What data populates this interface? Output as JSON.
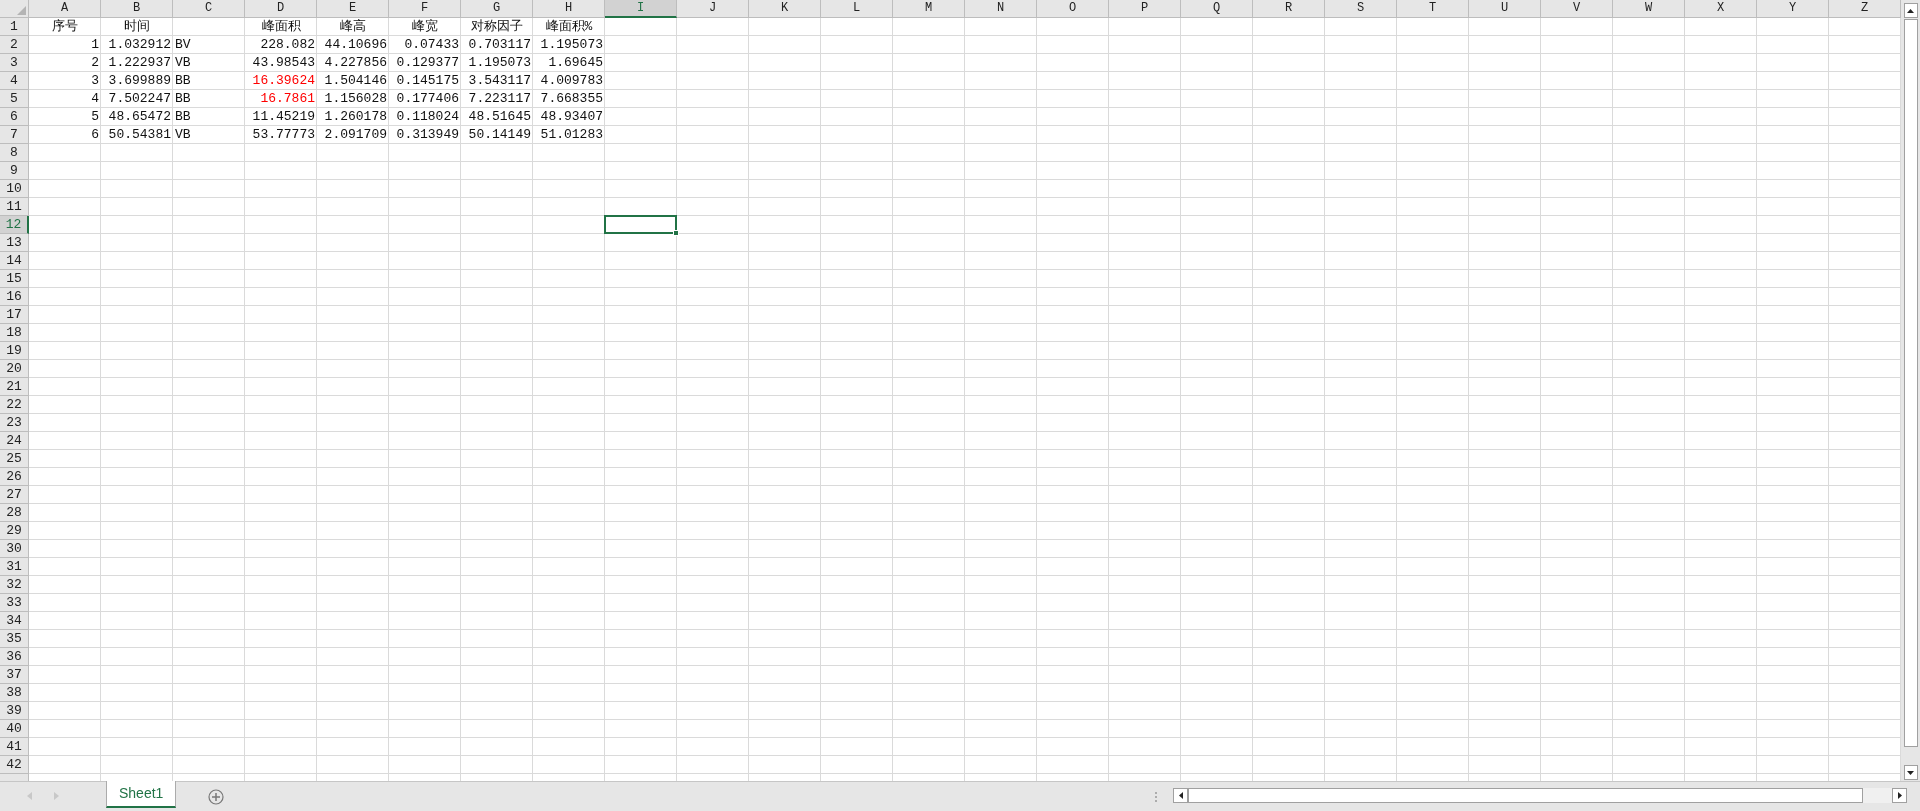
{
  "columns": [
    {
      "label": "A",
      "selected": false
    },
    {
      "label": "B",
      "selected": false
    },
    {
      "label": "C",
      "selected": false
    },
    {
      "label": "D",
      "selected": false
    },
    {
      "label": "E",
      "selected": false
    },
    {
      "label": "F",
      "selected": false
    },
    {
      "label": "G",
      "selected": false
    },
    {
      "label": "H",
      "selected": false
    },
    {
      "label": "I",
      "selected": true
    },
    {
      "label": "J",
      "selected": false
    },
    {
      "label": "K",
      "selected": false
    },
    {
      "label": "L",
      "selected": false
    },
    {
      "label": "M",
      "selected": false
    },
    {
      "label": "N",
      "selected": false
    },
    {
      "label": "O",
      "selected": false
    },
    {
      "label": "P",
      "selected": false
    },
    {
      "label": "Q",
      "selected": false
    },
    {
      "label": "R",
      "selected": false
    },
    {
      "label": "S",
      "selected": false
    },
    {
      "label": "T",
      "selected": false
    },
    {
      "label": "U",
      "selected": false
    },
    {
      "label": "V",
      "selected": false
    },
    {
      "label": "W",
      "selected": false
    },
    {
      "label": "X",
      "selected": false
    },
    {
      "label": "Y",
      "selected": false
    },
    {
      "label": "Z",
      "selected": false
    }
  ],
  "rows": [
    {
      "label": "1",
      "selected": false,
      "cells": [
        {
          "kind": "header",
          "text": "序号"
        },
        {
          "kind": "header",
          "text": "时间"
        },
        {
          "kind": "empty"
        },
        {
          "kind": "header",
          "text": "峰面积"
        },
        {
          "kind": "header",
          "text": "峰高"
        },
        {
          "kind": "header",
          "text": "峰宽"
        },
        {
          "kind": "header",
          "text": "对称因子"
        },
        {
          "kind": "header",
          "text": "峰面积%"
        }
      ]
    },
    {
      "label": "2",
      "selected": false,
      "cells": [
        {
          "kind": "number",
          "text": "1"
        },
        {
          "kind": "number",
          "text": "1.032912"
        },
        {
          "kind": "text",
          "text": "BV"
        },
        {
          "kind": "number",
          "text": "228.082"
        },
        {
          "kind": "number",
          "text": "44.10696"
        },
        {
          "kind": "number",
          "text": "0.07433"
        },
        {
          "kind": "number",
          "text": "0.703117"
        },
        {
          "kind": "number",
          "text": "1.195073"
        }
      ]
    },
    {
      "label": "3",
      "selected": false,
      "cells": [
        {
          "kind": "number",
          "text": "2"
        },
        {
          "kind": "number",
          "text": "1.222937"
        },
        {
          "kind": "text",
          "text": "VB"
        },
        {
          "kind": "number",
          "text": "43.98543"
        },
        {
          "kind": "number",
          "text": "4.227856"
        },
        {
          "kind": "number",
          "text": "0.129377"
        },
        {
          "kind": "number",
          "text": "1.195073"
        },
        {
          "kind": "number",
          "text": "1.69645"
        }
      ]
    },
    {
      "label": "4",
      "selected": false,
      "cells": [
        {
          "kind": "number",
          "text": "3"
        },
        {
          "kind": "number",
          "text": "3.699889"
        },
        {
          "kind": "text",
          "text": "BB"
        },
        {
          "kind": "number",
          "text": "16.39624",
          "color": "#ff0000"
        },
        {
          "kind": "number",
          "text": "1.504146"
        },
        {
          "kind": "number",
          "text": "0.145175"
        },
        {
          "kind": "number",
          "text": "3.543117"
        },
        {
          "kind": "number",
          "text": "4.009783"
        }
      ]
    },
    {
      "label": "5",
      "selected": false,
      "cells": [
        {
          "kind": "number",
          "text": "4"
        },
        {
          "kind": "number",
          "text": "7.502247"
        },
        {
          "kind": "text",
          "text": "BB"
        },
        {
          "kind": "number",
          "text": "16.7861",
          "color": "#ff0000"
        },
        {
          "kind": "number",
          "text": "1.156028"
        },
        {
          "kind": "number",
          "text": "0.177406"
        },
        {
          "kind": "number",
          "text": "7.223117"
        },
        {
          "kind": "number",
          "text": "7.668355"
        }
      ]
    },
    {
      "label": "6",
      "selected": false,
      "cells": [
        {
          "kind": "number",
          "text": "5"
        },
        {
          "kind": "number",
          "text": "48.65472"
        },
        {
          "kind": "text",
          "text": "BB"
        },
        {
          "kind": "number",
          "text": "11.45219"
        },
        {
          "kind": "number",
          "text": "1.260178"
        },
        {
          "kind": "number",
          "text": "0.118024"
        },
        {
          "kind": "number",
          "text": "48.51645"
        },
        {
          "kind": "number",
          "text": "48.93407"
        }
      ]
    },
    {
      "label": "7",
      "selected": false,
      "cells": [
        {
          "kind": "number",
          "text": "6"
        },
        {
          "kind": "number",
          "text": "50.54381"
        },
        {
          "kind": "text",
          "text": "VB"
        },
        {
          "kind": "number",
          "text": "53.77773"
        },
        {
          "kind": "number",
          "text": "2.091709"
        },
        {
          "kind": "number",
          "text": "0.313949"
        },
        {
          "kind": "number",
          "text": "50.14149"
        },
        {
          "kind": "number",
          "text": "51.01283"
        }
      ]
    },
    {
      "label": "8",
      "selected": false
    },
    {
      "label": "9",
      "selected": false
    },
    {
      "label": "10",
      "selected": false
    },
    {
      "label": "11",
      "selected": false
    },
    {
      "label": "12",
      "selected": true
    },
    {
      "label": "13",
      "selected": false
    },
    {
      "label": "14",
      "selected": false
    },
    {
      "label": "15",
      "selected": false
    },
    {
      "label": "16",
      "selected": false
    },
    {
      "label": "17",
      "selected": false
    },
    {
      "label": "18",
      "selected": false
    },
    {
      "label": "19",
      "selected": false
    },
    {
      "label": "20",
      "selected": false
    },
    {
      "label": "21",
      "selected": false
    },
    {
      "label": "22",
      "selected": false
    },
    {
      "label": "23",
      "selected": false
    },
    {
      "label": "24",
      "selected": false
    },
    {
      "label": "25",
      "selected": false
    },
    {
      "label": "26",
      "selected": false
    },
    {
      "label": "27",
      "selected": false
    },
    {
      "label": "28",
      "selected": false
    },
    {
      "label": "29",
      "selected": false
    },
    {
      "label": "30",
      "selected": false
    },
    {
      "label": "31",
      "selected": false
    },
    {
      "label": "32",
      "selected": false
    },
    {
      "label": "33",
      "selected": false
    },
    {
      "label": "34",
      "selected": false
    },
    {
      "label": "35",
      "selected": false
    },
    {
      "label": "36",
      "selected": false
    },
    {
      "label": "37",
      "selected": false
    },
    {
      "label": "38",
      "selected": false
    },
    {
      "label": "39",
      "selected": false
    },
    {
      "label": "40",
      "selected": false
    },
    {
      "label": "41",
      "selected": false
    },
    {
      "label": "42",
      "selected": false
    }
  ],
  "sheet_tabs": [
    {
      "label": "Sheet1",
      "selected": true
    }
  ]
}
